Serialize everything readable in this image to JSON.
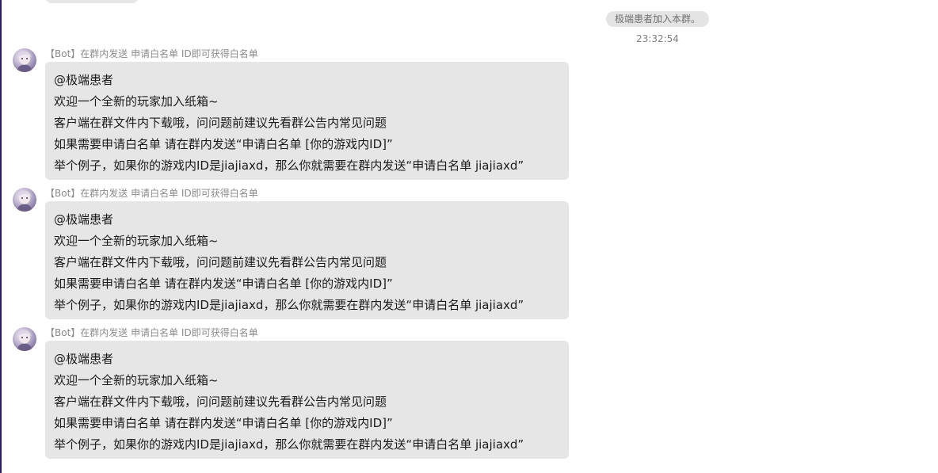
{
  "system": {
    "notice": "极端患者加入本群。",
    "time": "23:32:54"
  },
  "messages": [
    {
      "sender": "【Bot】在群内发送 申请白名单 ID即可获得白名单",
      "lines": [
        "@极端患者",
        "欢迎一个全新的玩家加入纸箱~",
        "客户端在群文件内下载哦，问问题前建议先看群公告内常见问题",
        "如果需要申请白名单 请在群内发送“申请白名单 [你的游戏内ID]”",
        "举个例子，如果你的游戏内ID是jiajiaxd，那么你就需要在群内发送“申请白名单 jiajiaxd”"
      ]
    },
    {
      "sender": "【Bot】在群内发送 申请白名单 ID即可获得白名单",
      "lines": [
        "@极端患者",
        "欢迎一个全新的玩家加入纸箱~",
        "客户端在群文件内下载哦，问问题前建议先看群公告内常见问题",
        "如果需要申请白名单 请在群内发送“申请白名单 [你的游戏内ID]”",
        "举个例子，如果你的游戏内ID是jiajiaxd，那么你就需要在群内发送“申请白名单 jiajiaxd”"
      ]
    },
    {
      "sender": "【Bot】在群内发送 申请白名单 ID即可获得白名单",
      "lines": [
        "@极端患者",
        "欢迎一个全新的玩家加入纸箱~",
        "客户端在群文件内下载哦，问问题前建议先看群公告内常见问题",
        "如果需要申请白名单 请在群内发送“申请白名单 [你的游戏内ID]”",
        "举个例子，如果你的游戏内ID是jiajiaxd，那么你就需要在群内发送“申请白名单 jiajiaxd”"
      ]
    }
  ]
}
